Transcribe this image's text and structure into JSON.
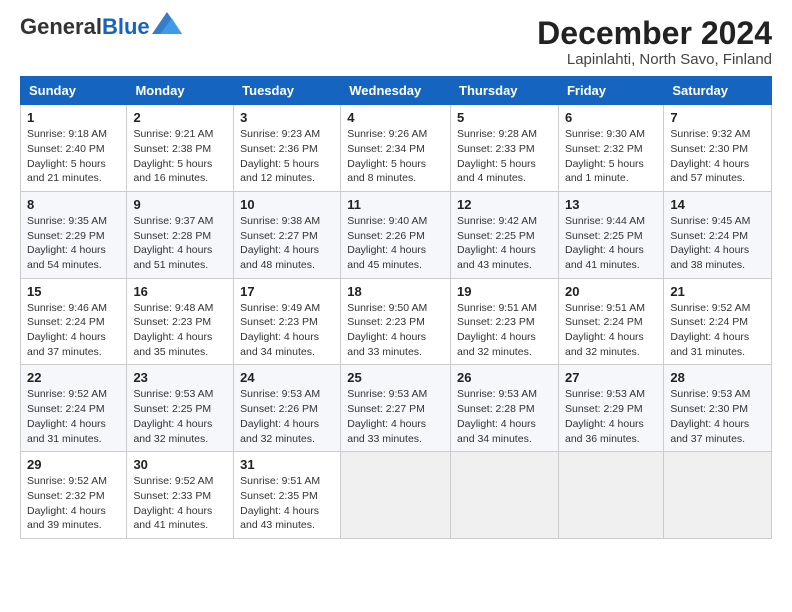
{
  "logo": {
    "general": "General",
    "blue": "Blue"
  },
  "title": "December 2024",
  "location": "Lapinlahti, North Savo, Finland",
  "days_of_week": [
    "Sunday",
    "Monday",
    "Tuesday",
    "Wednesday",
    "Thursday",
    "Friday",
    "Saturday"
  ],
  "weeks": [
    [
      {
        "day": "1",
        "sunrise": "9:18 AM",
        "sunset": "2:40 PM",
        "daylight": "5 hours and 21 minutes."
      },
      {
        "day": "2",
        "sunrise": "9:21 AM",
        "sunset": "2:38 PM",
        "daylight": "5 hours and 16 minutes."
      },
      {
        "day": "3",
        "sunrise": "9:23 AM",
        "sunset": "2:36 PM",
        "daylight": "5 hours and 12 minutes."
      },
      {
        "day": "4",
        "sunrise": "9:26 AM",
        "sunset": "2:34 PM",
        "daylight": "5 hours and 8 minutes."
      },
      {
        "day": "5",
        "sunrise": "9:28 AM",
        "sunset": "2:33 PM",
        "daylight": "5 hours and 4 minutes."
      },
      {
        "day": "6",
        "sunrise": "9:30 AM",
        "sunset": "2:32 PM",
        "daylight": "5 hours and 1 minute."
      },
      {
        "day": "7",
        "sunrise": "9:32 AM",
        "sunset": "2:30 PM",
        "daylight": "4 hours and 57 minutes."
      }
    ],
    [
      {
        "day": "8",
        "sunrise": "9:35 AM",
        "sunset": "2:29 PM",
        "daylight": "4 hours and 54 minutes."
      },
      {
        "day": "9",
        "sunrise": "9:37 AM",
        "sunset": "2:28 PM",
        "daylight": "4 hours and 51 minutes."
      },
      {
        "day": "10",
        "sunrise": "9:38 AM",
        "sunset": "2:27 PM",
        "daylight": "4 hours and 48 minutes."
      },
      {
        "day": "11",
        "sunrise": "9:40 AM",
        "sunset": "2:26 PM",
        "daylight": "4 hours and 45 minutes."
      },
      {
        "day": "12",
        "sunrise": "9:42 AM",
        "sunset": "2:25 PM",
        "daylight": "4 hours and 43 minutes."
      },
      {
        "day": "13",
        "sunrise": "9:44 AM",
        "sunset": "2:25 PM",
        "daylight": "4 hours and 41 minutes."
      },
      {
        "day": "14",
        "sunrise": "9:45 AM",
        "sunset": "2:24 PM",
        "daylight": "4 hours and 38 minutes."
      }
    ],
    [
      {
        "day": "15",
        "sunrise": "9:46 AM",
        "sunset": "2:24 PM",
        "daylight": "4 hours and 37 minutes."
      },
      {
        "day": "16",
        "sunrise": "9:48 AM",
        "sunset": "2:23 PM",
        "daylight": "4 hours and 35 minutes."
      },
      {
        "day": "17",
        "sunrise": "9:49 AM",
        "sunset": "2:23 PM",
        "daylight": "4 hours and 34 minutes."
      },
      {
        "day": "18",
        "sunrise": "9:50 AM",
        "sunset": "2:23 PM",
        "daylight": "4 hours and 33 minutes."
      },
      {
        "day": "19",
        "sunrise": "9:51 AM",
        "sunset": "2:23 PM",
        "daylight": "4 hours and 32 minutes."
      },
      {
        "day": "20",
        "sunrise": "9:51 AM",
        "sunset": "2:24 PM",
        "daylight": "4 hours and 32 minutes."
      },
      {
        "day": "21",
        "sunrise": "9:52 AM",
        "sunset": "2:24 PM",
        "daylight": "4 hours and 31 minutes."
      }
    ],
    [
      {
        "day": "22",
        "sunrise": "9:52 AM",
        "sunset": "2:24 PM",
        "daylight": "4 hours and 31 minutes."
      },
      {
        "day": "23",
        "sunrise": "9:53 AM",
        "sunset": "2:25 PM",
        "daylight": "4 hours and 32 minutes."
      },
      {
        "day": "24",
        "sunrise": "9:53 AM",
        "sunset": "2:26 PM",
        "daylight": "4 hours and 32 minutes."
      },
      {
        "day": "25",
        "sunrise": "9:53 AM",
        "sunset": "2:27 PM",
        "daylight": "4 hours and 33 minutes."
      },
      {
        "day": "26",
        "sunrise": "9:53 AM",
        "sunset": "2:28 PM",
        "daylight": "4 hours and 34 minutes."
      },
      {
        "day": "27",
        "sunrise": "9:53 AM",
        "sunset": "2:29 PM",
        "daylight": "4 hours and 36 minutes."
      },
      {
        "day": "28",
        "sunrise": "9:53 AM",
        "sunset": "2:30 PM",
        "daylight": "4 hours and 37 minutes."
      }
    ],
    [
      {
        "day": "29",
        "sunrise": "9:52 AM",
        "sunset": "2:32 PM",
        "daylight": "4 hours and 39 minutes."
      },
      {
        "day": "30",
        "sunrise": "9:52 AM",
        "sunset": "2:33 PM",
        "daylight": "4 hours and 41 minutes."
      },
      {
        "day": "31",
        "sunrise": "9:51 AM",
        "sunset": "2:35 PM",
        "daylight": "4 hours and 43 minutes."
      },
      null,
      null,
      null,
      null
    ]
  ],
  "labels": {
    "sunrise": "Sunrise:",
    "sunset": "Sunset:",
    "daylight": "Daylight:"
  }
}
